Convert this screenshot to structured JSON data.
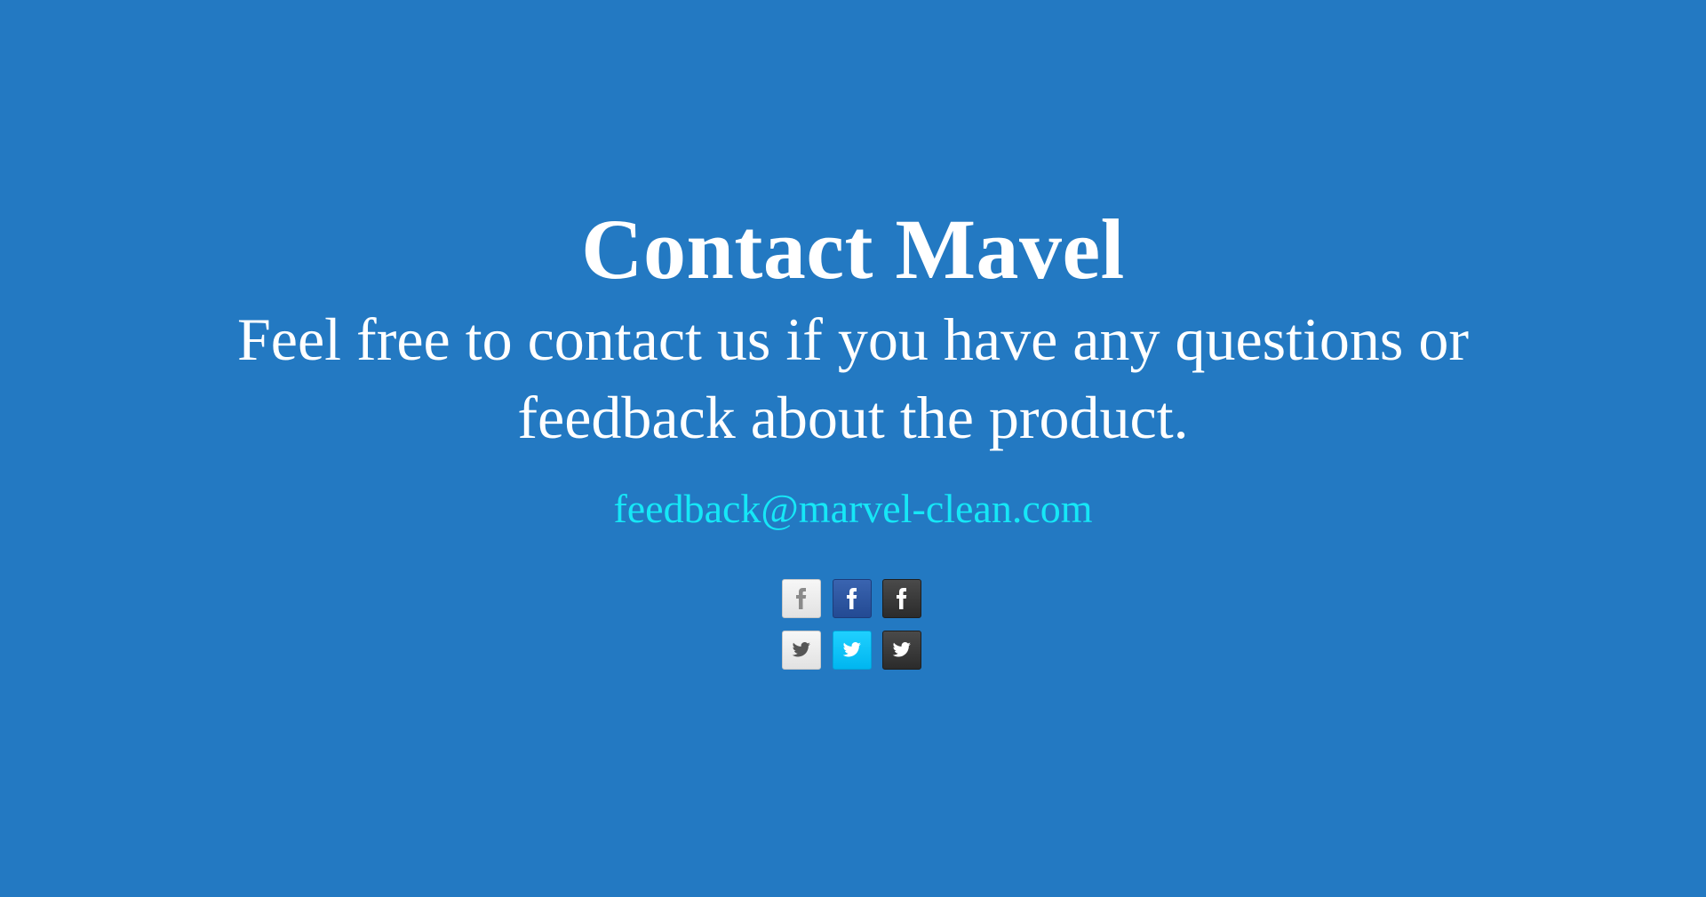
{
  "contact": {
    "title": "Contact Mavel",
    "subtitle": "Feel free to contact us if you have any questions or feedback about the product.",
    "email": "feedback@marvel-clean.com"
  },
  "social": {
    "buttons": [
      {
        "icon": "facebook-icon",
        "style": "light",
        "color": "#eeeeee"
      },
      {
        "icon": "facebook-icon",
        "style": "blue",
        "color": "#2d55a0"
      },
      {
        "icon": "facebook-icon",
        "style": "dark",
        "color": "#333333"
      },
      {
        "icon": "twitter-icon",
        "style": "light",
        "color": "#eeeeee"
      },
      {
        "icon": "twitter-icon",
        "style": "blue",
        "color": "#00c4f5"
      },
      {
        "icon": "twitter-icon",
        "style": "dark",
        "color": "#333333"
      }
    ]
  },
  "colors": {
    "background": "#2379c2",
    "text": "#ffffff",
    "link": "#16e7f7"
  }
}
